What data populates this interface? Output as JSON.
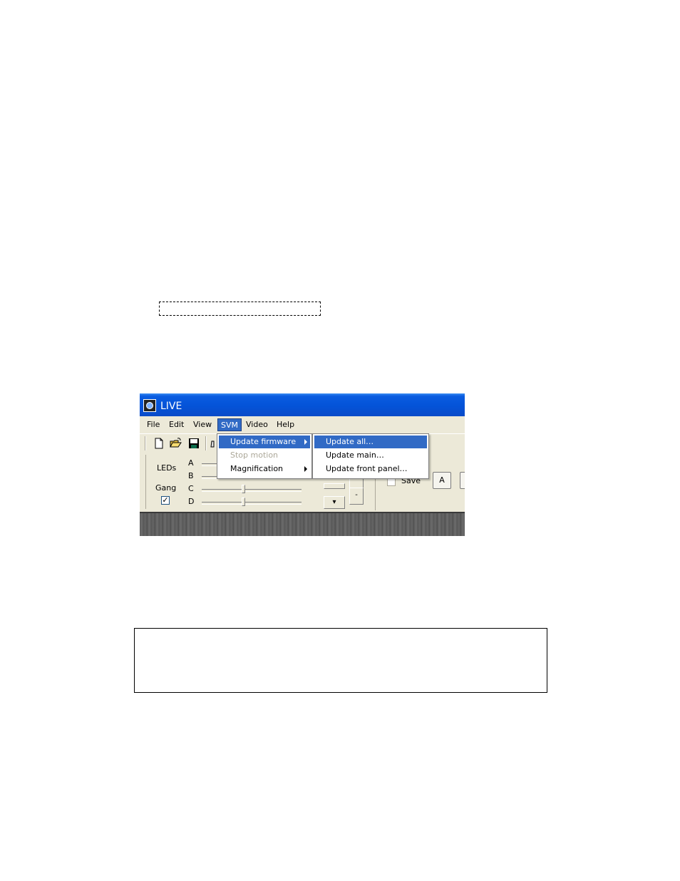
{
  "window": {
    "title": "LIVE"
  },
  "menubar": {
    "items": [
      "File",
      "Edit",
      "View",
      "SVM",
      "Video",
      "Help"
    ],
    "active": "SVM"
  },
  "svm_menu": {
    "items": [
      {
        "label": "Update firmware",
        "has_submenu": true,
        "highlighted": true,
        "disabled": false
      },
      {
        "label": "Stop motion",
        "has_submenu": false,
        "highlighted": false,
        "disabled": true
      },
      {
        "label": "Magnification",
        "has_submenu": true,
        "highlighted": false,
        "disabled": false
      }
    ]
  },
  "firmware_submenu": {
    "items": [
      {
        "label": "Update all…",
        "highlighted": true
      },
      {
        "label": "Update main…",
        "highlighted": false
      },
      {
        "label": "Update front panel…",
        "highlighted": false
      }
    ]
  },
  "toolbar": {
    "icons": [
      "new-file-icon",
      "open-folder-icon",
      "save-disk-icon",
      "print-icon"
    ]
  },
  "led_panel": {
    "leds_label": "LEDs",
    "gang_label": "Gang",
    "gang_checked": true,
    "gang_check_glyph": "✓",
    "channels": [
      "A",
      "B",
      "C",
      "D"
    ]
  },
  "save_panel": {
    "save_label": "Save",
    "a_button_label": "A"
  },
  "spin": {
    "up_glyph": "▾",
    "dot1": "·",
    "dot2": "-"
  },
  "colors": {
    "titlebar": "#0453d8",
    "highlight": "#316ac5",
    "window_bg": "#ece9d8"
  }
}
